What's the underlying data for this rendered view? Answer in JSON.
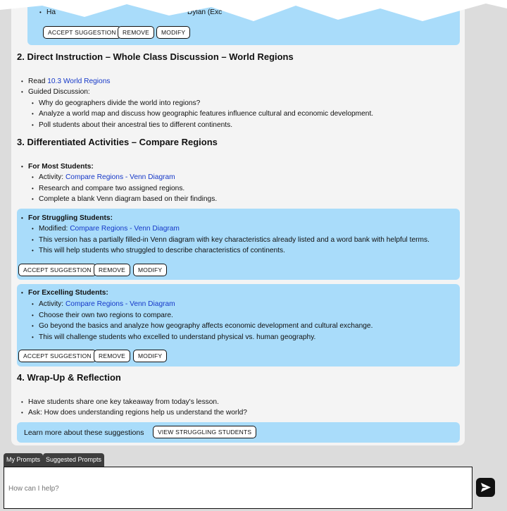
{
  "top_fragment": {
    "left_text": "Ha",
    "right_text": "Dylan (Exc"
  },
  "suggestion_actions": {
    "accept": "ACCEPT SUGGESTION",
    "remove": "REMOVE",
    "modify": "MODIFY"
  },
  "section2": {
    "heading": "2. Direct Instruction – Whole Class Discussion – World Regions",
    "read_prefix": "Read",
    "read_link": "10.3 World Regions",
    "guided_label": "Guided Discussion:",
    "items": [
      "Why do geographers divide the world into regions?",
      "Analyze a world map and discuss how geographic features influence cultural and economic development.",
      "Poll students about their ancestral ties to different continents."
    ]
  },
  "section3": {
    "heading": "3. Differentiated Activities – Compare Regions",
    "most": {
      "label": "For Most Students:",
      "activity_prefix": "Activity:",
      "activity_link": "Compare Regions - Venn Diagram",
      "items": [
        "Research and compare two assigned regions.",
        "Complete a blank Venn diagram based on their findings."
      ]
    },
    "struggling": {
      "label": "For Struggling Students:",
      "activity_prefix": "Modified:",
      "activity_link": "Compare Regions - Venn Diagram",
      "items": [
        "This version has a partially filled-in Venn diagram with key characteristics already listed and a word bank with helpful terms.",
        "This will help students who struggled to describe characteristics of continents."
      ]
    },
    "excelling": {
      "label": "For Excelling Students:",
      "activity_prefix": "Activity:",
      "activity_link": "Compare Regions - Venn Diagram",
      "items": [
        "Choose their own two regions to compare.",
        "Go beyond the basics and analyze how geography affects economic development and cultural exchange.",
        "This will challenge students who excelled to understand physical vs. human geography."
      ]
    }
  },
  "section4": {
    "heading": "4. Wrap-Up & Reflection",
    "items": [
      "Have students share one key takeaway from today's lesson.",
      "Ask: How does understanding regions help us understand the world?"
    ]
  },
  "learn_more": {
    "text": "Learn more about these suggestions",
    "button": "VIEW STRUGGLING STUDENTS"
  },
  "prompt_tabs": [
    "My Prompts",
    "Suggested Prompts"
  ],
  "prompt_input": {
    "placeholder": "How can I help?",
    "value": ""
  },
  "colors": {
    "suggestion_panel": "#a9dcfa",
    "link": "#1538c8",
    "page": "#f4f4f4",
    "background": "#dcdcdc"
  },
  "icons": {
    "send": "send-icon"
  }
}
